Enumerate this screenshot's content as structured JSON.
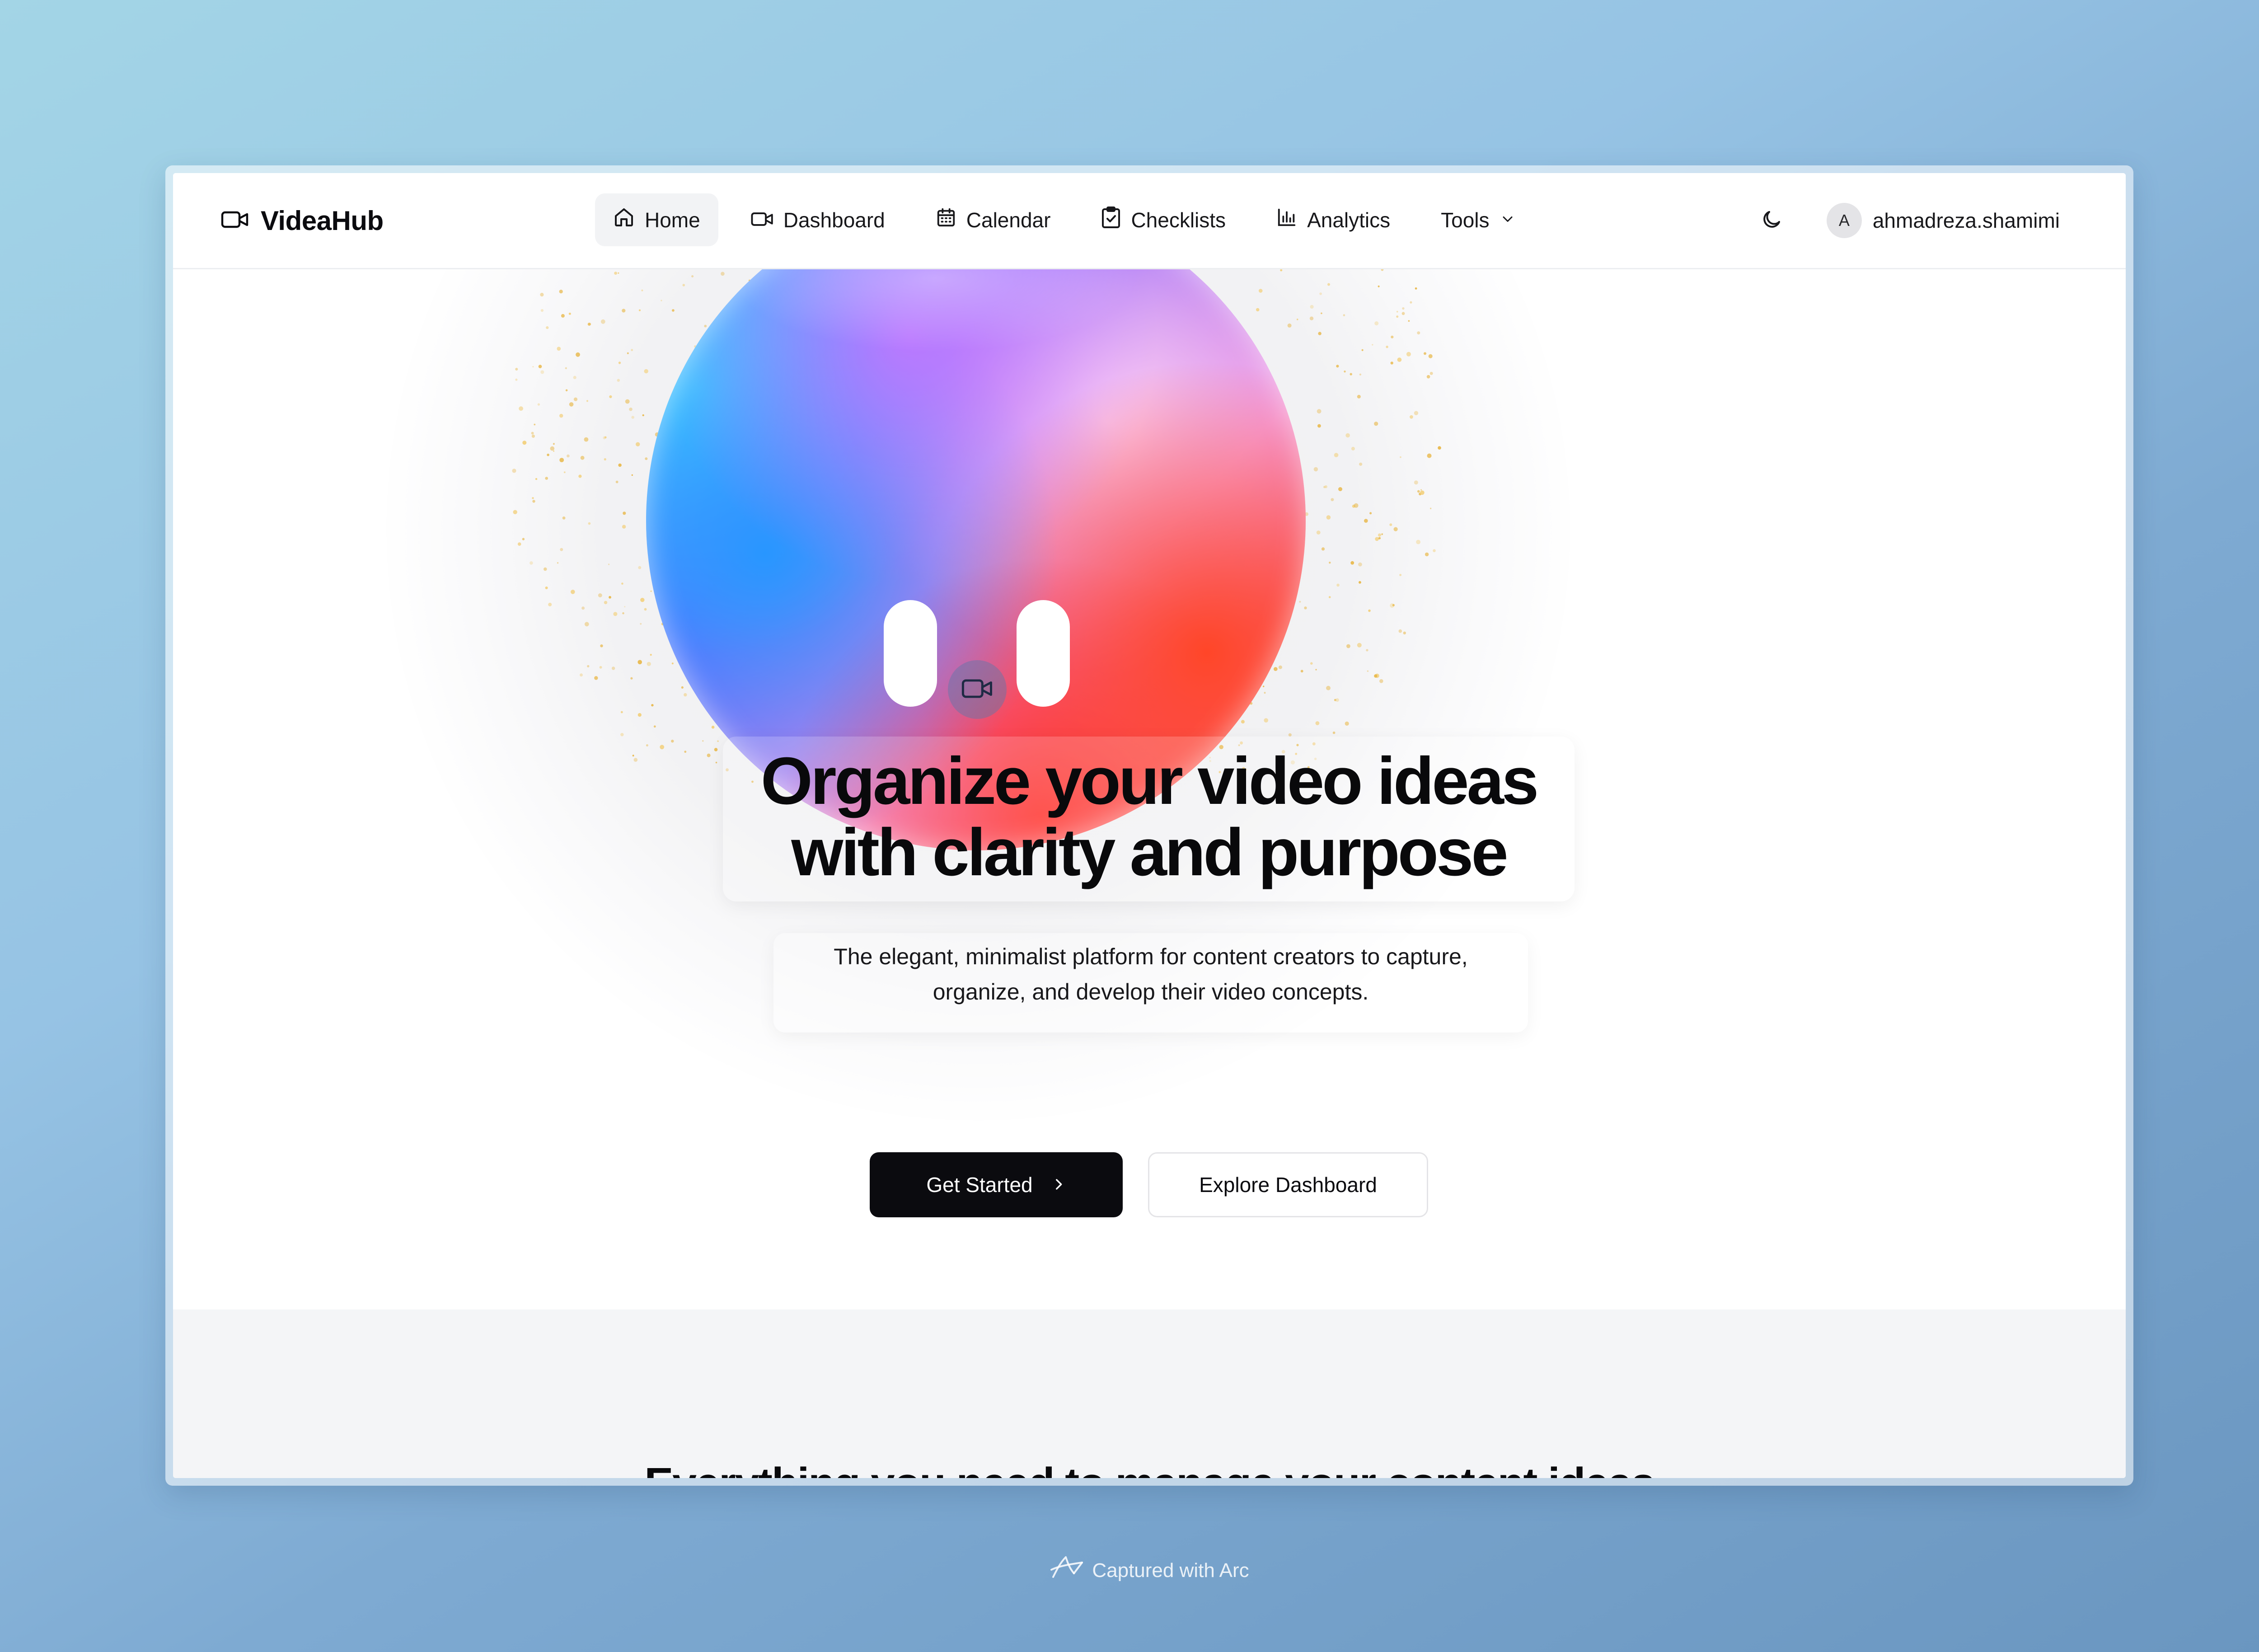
{
  "app": {
    "brand_name": "VideaHub",
    "brand_icon": "video-camera-icon"
  },
  "nav": {
    "items": [
      {
        "label": "Home",
        "icon": "home-icon",
        "active": true
      },
      {
        "label": "Dashboard",
        "icon": "video-camera-icon",
        "active": false
      },
      {
        "label": "Calendar",
        "icon": "calendar-icon",
        "active": false
      },
      {
        "label": "Checklists",
        "icon": "clipboard-check-icon",
        "active": false
      },
      {
        "label": "Analytics",
        "icon": "bar-chart-icon",
        "active": false
      },
      {
        "label": "Tools",
        "icon": "chevron-down-icon",
        "active": false
      }
    ],
    "theme_toggle_icon": "moon-icon",
    "user": {
      "avatar_initial": "A",
      "username": "ahmadreza.shamimi"
    }
  },
  "hero": {
    "headline_line1": "Organize your video ideas",
    "headline_line2": "with clarity and purpose",
    "subtitle_line1": "The elegant, minimalist platform for content creators to capture,",
    "subtitle_line2": "organize, and develop their video concepts.",
    "primary_cta": "Get Started",
    "secondary_cta": "Explore Dashboard"
  },
  "features": {
    "title": "Everything you need to manage your content ideas"
  },
  "capture": {
    "label": "Captured with Arc"
  },
  "colors": {
    "primary_button": "#0b0b0f",
    "active_nav_bg": "#f2f3f5",
    "features_bg": "#f4f5f7"
  }
}
